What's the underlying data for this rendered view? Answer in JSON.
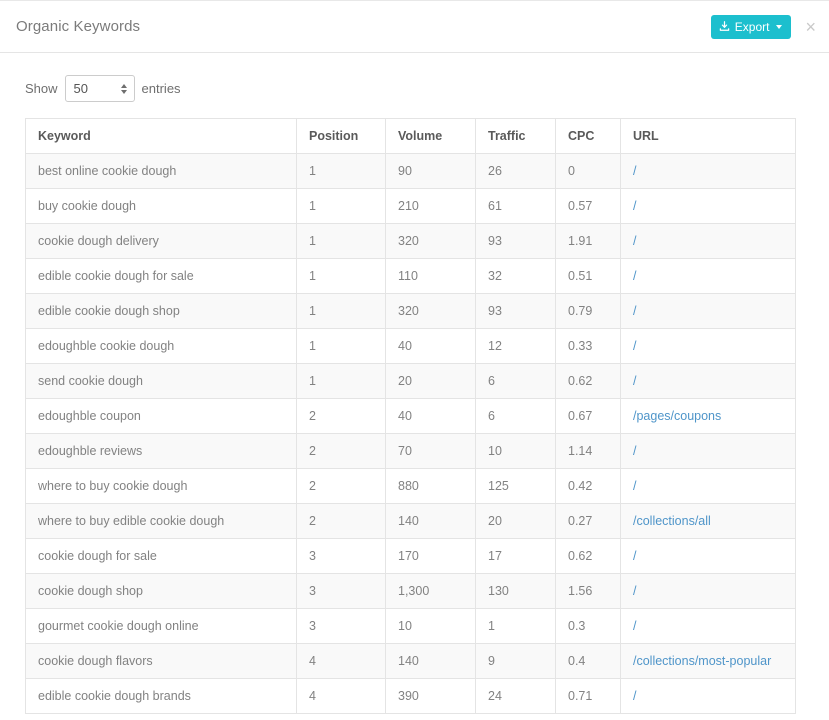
{
  "header": {
    "title": "Organic Keywords",
    "export_label": "Export",
    "export_icon": "download-icon",
    "caret_icon": "caret-down-icon",
    "close_label": "×",
    "accent_color": "#1cbfce",
    "link_color": "#4f95c9"
  },
  "length_control": {
    "show_label": "Show",
    "entries_label": "entries",
    "value": "50"
  },
  "table": {
    "columns": [
      "Keyword",
      "Position",
      "Volume",
      "Traffic",
      "CPC",
      "URL"
    ],
    "rows": [
      {
        "keyword": "best online cookie dough",
        "position": "1",
        "volume": "90",
        "traffic": "26",
        "cpc": "0",
        "url": "/"
      },
      {
        "keyword": "buy cookie dough",
        "position": "1",
        "volume": "210",
        "traffic": "61",
        "cpc": "0.57",
        "url": "/"
      },
      {
        "keyword": "cookie dough delivery",
        "position": "1",
        "volume": "320",
        "traffic": "93",
        "cpc": "1.91",
        "url": "/"
      },
      {
        "keyword": "edible cookie dough for sale",
        "position": "1",
        "volume": "110",
        "traffic": "32",
        "cpc": "0.51",
        "url": "/"
      },
      {
        "keyword": "edible cookie dough shop",
        "position": "1",
        "volume": "320",
        "traffic": "93",
        "cpc": "0.79",
        "url": "/"
      },
      {
        "keyword": "edoughble cookie dough",
        "position": "1",
        "volume": "40",
        "traffic": "12",
        "cpc": "0.33",
        "url": "/"
      },
      {
        "keyword": "send cookie dough",
        "position": "1",
        "volume": "20",
        "traffic": "6",
        "cpc": "0.62",
        "url": "/"
      },
      {
        "keyword": "edoughble coupon",
        "position": "2",
        "volume": "40",
        "traffic": "6",
        "cpc": "0.67",
        "url": "/pages/coupons"
      },
      {
        "keyword": "edoughble reviews",
        "position": "2",
        "volume": "70",
        "traffic": "10",
        "cpc": "1.14",
        "url": "/"
      },
      {
        "keyword": "where to buy cookie dough",
        "position": "2",
        "volume": "880",
        "traffic": "125",
        "cpc": "0.42",
        "url": "/"
      },
      {
        "keyword": "where to buy edible cookie dough",
        "position": "2",
        "volume": "140",
        "traffic": "20",
        "cpc": "0.27",
        "url": "/collections/all"
      },
      {
        "keyword": "cookie dough for sale",
        "position": "3",
        "volume": "170",
        "traffic": "17",
        "cpc": "0.62",
        "url": "/"
      },
      {
        "keyword": "cookie dough shop",
        "position": "3",
        "volume": "1,300",
        "traffic": "130",
        "cpc": "1.56",
        "url": "/"
      },
      {
        "keyword": "gourmet cookie dough online",
        "position": "3",
        "volume": "10",
        "traffic": "1",
        "cpc": "0.3",
        "url": "/"
      },
      {
        "keyword": "cookie dough flavors",
        "position": "4",
        "volume": "140",
        "traffic": "9",
        "cpc": "0.4",
        "url": "/collections/most-popular"
      },
      {
        "keyword": "edible cookie dough brands",
        "position": "4",
        "volume": "390",
        "traffic": "24",
        "cpc": "0.71",
        "url": "/"
      }
    ]
  }
}
